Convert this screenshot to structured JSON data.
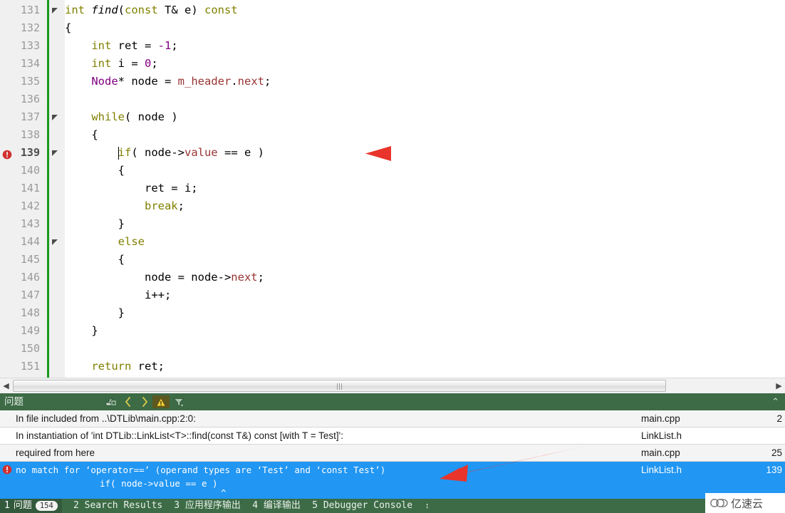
{
  "editor": {
    "first_line": 131,
    "lines": [
      {
        "n": 131,
        "fold": true,
        "error": false,
        "tokens": [
          {
            "t": "int ",
            "c": "k"
          },
          {
            "t": "find",
            "c": "fn"
          },
          {
            "t": "(",
            "c": "pl"
          },
          {
            "t": "const",
            "c": "k"
          },
          {
            "t": " T& e) ",
            "c": "pl"
          },
          {
            "t": "const",
            "c": "k"
          }
        ]
      },
      {
        "n": 132,
        "fold": false,
        "error": false,
        "tokens": [
          {
            "t": "{",
            "c": "pl"
          }
        ]
      },
      {
        "n": 133,
        "fold": false,
        "error": false,
        "tokens": [
          {
            "t": "    ",
            "c": "pl"
          },
          {
            "t": "int",
            "c": "k"
          },
          {
            "t": " ret = ",
            "c": "pl"
          },
          {
            "t": "-1",
            "c": "num"
          },
          {
            "t": ";",
            "c": "pl"
          }
        ]
      },
      {
        "n": 134,
        "fold": false,
        "error": false,
        "tokens": [
          {
            "t": "    ",
            "c": "pl"
          },
          {
            "t": "int",
            "c": "k"
          },
          {
            "t": " i = ",
            "c": "pl"
          },
          {
            "t": "0",
            "c": "num"
          },
          {
            "t": ";",
            "c": "pl"
          }
        ]
      },
      {
        "n": 135,
        "fold": false,
        "error": false,
        "tokens": [
          {
            "t": "    ",
            "c": "pl"
          },
          {
            "t": "Node",
            "c": "ty"
          },
          {
            "t": "* node = ",
            "c": "pl"
          },
          {
            "t": "m_header",
            "c": "mem"
          },
          {
            "t": ".",
            "c": "pl"
          },
          {
            "t": "next",
            "c": "mem"
          },
          {
            "t": ";",
            "c": "pl"
          }
        ]
      },
      {
        "n": 136,
        "fold": false,
        "error": false,
        "tokens": []
      },
      {
        "n": 137,
        "fold": true,
        "error": false,
        "tokens": [
          {
            "t": "    ",
            "c": "pl"
          },
          {
            "t": "while",
            "c": "k"
          },
          {
            "t": "( node )",
            "c": "pl"
          }
        ]
      },
      {
        "n": 138,
        "fold": false,
        "error": false,
        "tokens": [
          {
            "t": "    {",
            "c": "pl"
          }
        ]
      },
      {
        "n": 139,
        "fold": true,
        "error": true,
        "tokens": [
          {
            "t": "        ",
            "c": "pl"
          },
          {
            "t": "if",
            "c": "k"
          },
          {
            "t": "( node->",
            "c": "pl"
          },
          {
            "t": "value",
            "c": "mem"
          },
          {
            "t": " == e )",
            "c": "pl"
          }
        ]
      },
      {
        "n": 140,
        "fold": false,
        "error": false,
        "tokens": [
          {
            "t": "        {",
            "c": "pl"
          }
        ]
      },
      {
        "n": 141,
        "fold": false,
        "error": false,
        "tokens": [
          {
            "t": "            ret = i;",
            "c": "pl"
          }
        ]
      },
      {
        "n": 142,
        "fold": false,
        "error": false,
        "tokens": [
          {
            "t": "            ",
            "c": "pl"
          },
          {
            "t": "break",
            "c": "k"
          },
          {
            "t": ";",
            "c": "pl"
          }
        ]
      },
      {
        "n": 143,
        "fold": false,
        "error": false,
        "tokens": [
          {
            "t": "        }",
            "c": "pl"
          }
        ]
      },
      {
        "n": 144,
        "fold": true,
        "error": false,
        "tokens": [
          {
            "t": "        ",
            "c": "pl"
          },
          {
            "t": "else",
            "c": "k"
          }
        ]
      },
      {
        "n": 145,
        "fold": false,
        "error": false,
        "tokens": [
          {
            "t": "        {",
            "c": "pl"
          }
        ]
      },
      {
        "n": 146,
        "fold": false,
        "error": false,
        "tokens": [
          {
            "t": "            node = node->",
            "c": "pl"
          },
          {
            "t": "next",
            "c": "mem"
          },
          {
            "t": ";",
            "c": "pl"
          }
        ]
      },
      {
        "n": 147,
        "fold": false,
        "error": false,
        "tokens": [
          {
            "t": "            i++;",
            "c": "pl"
          }
        ]
      },
      {
        "n": 148,
        "fold": false,
        "error": false,
        "tokens": [
          {
            "t": "        }",
            "c": "pl"
          }
        ]
      },
      {
        "n": 149,
        "fold": false,
        "error": false,
        "tokens": [
          {
            "t": "    }",
            "c": "pl"
          }
        ]
      },
      {
        "n": 150,
        "fold": false,
        "error": false,
        "tokens": []
      },
      {
        "n": 151,
        "fold": false,
        "error": false,
        "tokens": [
          {
            "t": "    ",
            "c": "pl"
          },
          {
            "t": "return",
            "c": "k"
          },
          {
            "t": " ret;",
            "c": "pl"
          }
        ]
      }
    ]
  },
  "scrollbar": {
    "left_arrow": "◀",
    "right_arrow": "▶"
  },
  "panel": {
    "title": "问题",
    "tools": [
      {
        "name": "clear-icon",
        "glyph": "⎇"
      },
      {
        "name": "previous-icon",
        "glyph": "‹"
      },
      {
        "name": "next-icon",
        "glyph": "›"
      },
      {
        "name": "warning-filter-icon",
        "glyph": "⚠"
      },
      {
        "name": "filter-icon",
        "glyph": "ὓB"
      }
    ],
    "collapse_glyph": "⌃",
    "rows": [
      {
        "message": "In file included from ..\\DTLib\\main.cpp:2:0:",
        "file": "main.cpp",
        "line": "2"
      },
      {
        "message": "In instantiation of 'int DTLib::LinkList<T>::find(const T&) const [with T = Test]':",
        "file": "LinkList.h",
        "line": ""
      },
      {
        "message": "required from here",
        "file": "main.cpp",
        "line": "25"
      }
    ],
    "selected": {
      "message_line1": "no match for ‘operator==’ (operand types are ‘Test’ and ‘const Test’)",
      "message_line2": "if( node->value == e )",
      "caret_marker": "^",
      "file": "LinkList.h",
      "line": "139"
    }
  },
  "status": {
    "tabs": [
      {
        "num": "1",
        "label": "问题",
        "badge": "154",
        "active": true
      },
      {
        "num": "2",
        "label": "Search Results",
        "badge": "",
        "active": false
      },
      {
        "num": "3",
        "label": "应用程序输出",
        "badge": "",
        "active": false
      },
      {
        "num": "4",
        "label": "编译输出",
        "badge": "",
        "active": false
      },
      {
        "num": "5",
        "label": "Debugger Console",
        "badge": "",
        "active": false
      }
    ],
    "updown_glyph": "↕"
  },
  "watermark": {
    "text": "亿速云"
  },
  "colors": {
    "panel_header": "#3c6b46",
    "selection": "#2196f3",
    "annotation_arrow": "#e8342a",
    "gutter_green": "#1a9a1a"
  }
}
